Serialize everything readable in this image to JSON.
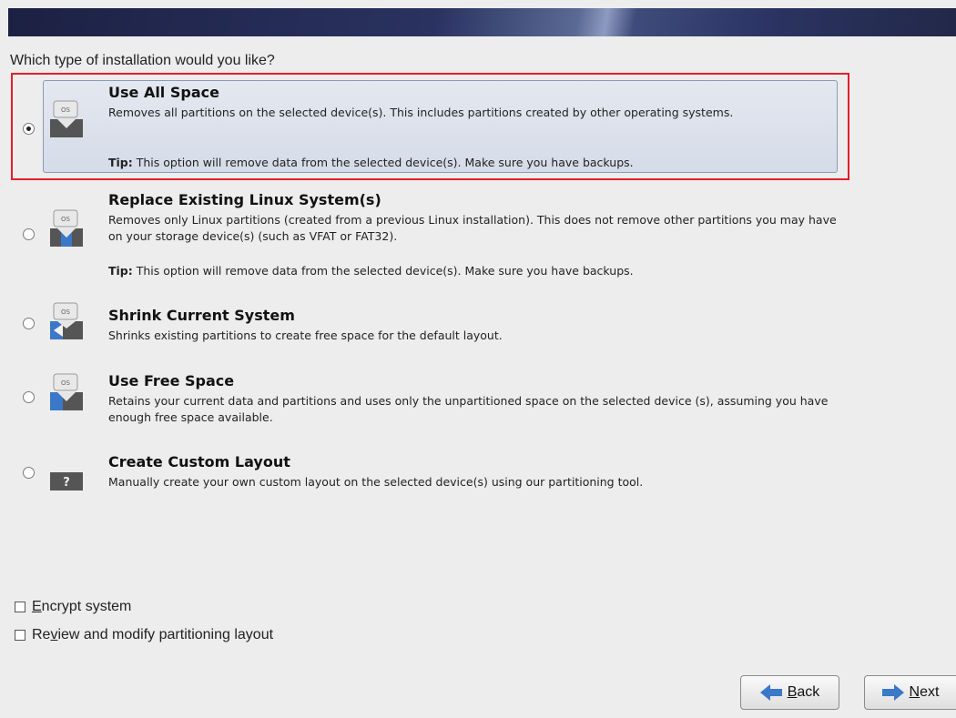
{
  "question": "Which type of installation would you like?",
  "options": [
    {
      "title": "Use All Space",
      "description": "Removes all partitions on the selected device(s).  This includes partitions created by other operating systems.",
      "tip_label": "Tip:",
      "tip_text": " This option will remove data from the selected device(s).  Make sure you have backups.",
      "selected": true
    },
    {
      "title": "Replace Existing Linux System(s)",
      "description": "Removes only Linux partitions (created from a previous Linux installation).  This does not remove other partitions you may have on your storage device(s) (such as VFAT or FAT32).",
      "tip_label": "Tip:",
      "tip_text": " This option will remove data from the selected device(s).  Make sure you have backups.",
      "selected": false
    },
    {
      "title": "Shrink Current System",
      "description": "Shrinks existing partitions to create free space for the default layout.",
      "selected": false
    },
    {
      "title": "Use Free Space",
      "description": "Retains your current data and partitions and uses only the unpartitioned space on the selected device (s), assuming you have enough free space available.",
      "selected": false
    },
    {
      "title": "Create Custom Layout",
      "description": "Manually create your own custom layout on the selected device(s) using our partitioning tool.",
      "selected": false
    }
  ],
  "icon_label": "OS",
  "custom_icon_label": "?",
  "checkboxes": {
    "encrypt": {
      "mnemonic": "E",
      "rest": "ncrypt system",
      "checked": false
    },
    "review": {
      "pre": "Re",
      "mnemonic": "v",
      "rest": "iew and modify partitioning layout",
      "checked": false
    }
  },
  "buttons": {
    "back": {
      "mnemonic": "B",
      "rest": "ack"
    },
    "next": {
      "mnemonic": "N",
      "rest": "ext"
    }
  },
  "colors": {
    "highlight": "#e0202a",
    "arrow": "#3b78c8",
    "banner": "#222848"
  }
}
